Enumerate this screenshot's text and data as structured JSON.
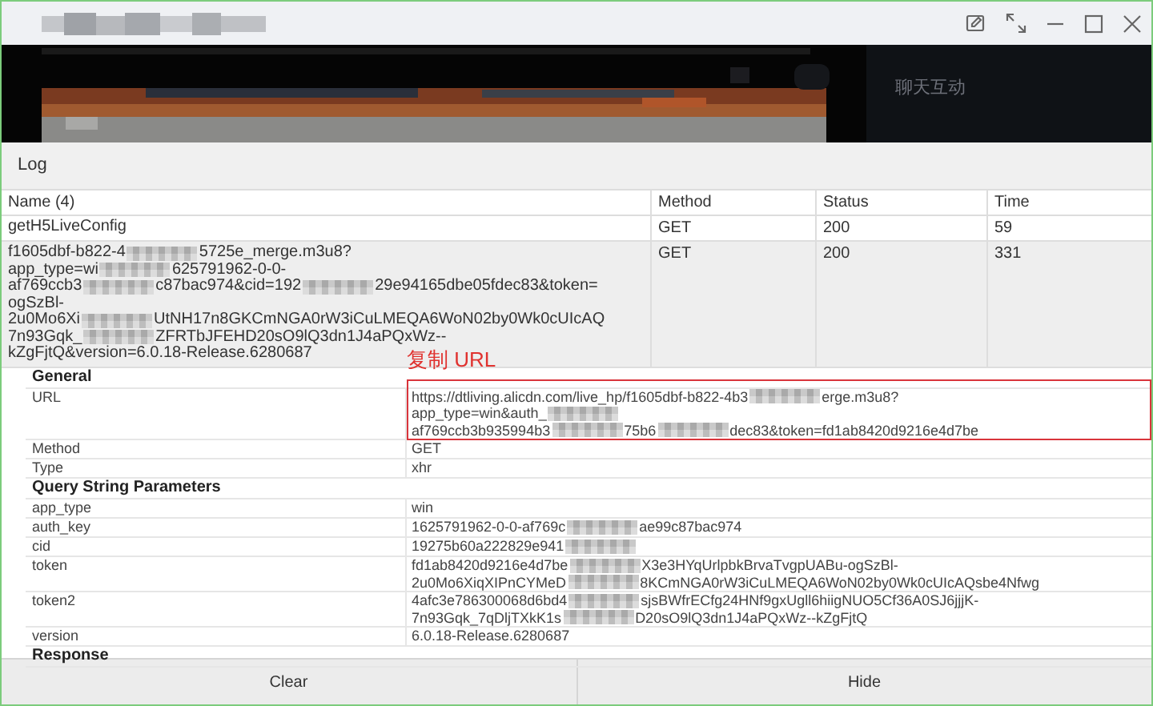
{
  "window": {
    "side_panel_title": "聊天互动"
  },
  "log_bar": {
    "title": "Log"
  },
  "table": {
    "columns": [
      "Name (4)",
      "Method",
      "Status",
      "Time"
    ],
    "rows": [
      {
        "selected": false,
        "name_lines": [
          [
            {
              "kind": "text",
              "text": "getH5LiveConfig"
            }
          ]
        ],
        "method": "GET",
        "status": "200",
        "time": "59"
      },
      {
        "selected": true,
        "name_lines": [
          [
            {
              "kind": "text",
              "text": "f1605dbf-b822-4"
            },
            {
              "kind": "blur"
            },
            {
              "kind": "text",
              "text": "5725e_merge.m3u8?"
            }
          ],
          [
            {
              "kind": "text",
              "text": "app_type=wi"
            },
            {
              "kind": "blur"
            },
            {
              "kind": "text",
              "text": "625791962-0-0-"
            }
          ],
          [
            {
              "kind": "text",
              "text": "af769ccb3"
            },
            {
              "kind": "blur"
            },
            {
              "kind": "text",
              "text": "c87bac974&cid=192"
            },
            {
              "kind": "blur"
            },
            {
              "kind": "text",
              "text": "29e94165dbe05fdec83&token="
            }
          ],
          [
            {
              "kind": "text",
              "text": "ogSzBl-"
            }
          ],
          [
            {
              "kind": "text",
              "text": "2u0Mo6Xi"
            },
            {
              "kind": "blur"
            },
            {
              "kind": "text",
              "text": "UtNH17n8GKCmNGA0rW3iCuLMEQA6WoN02by0Wk0cUIcAQ"
            }
          ],
          [
            {
              "kind": "text",
              "text": "7n93Gqk_"
            },
            {
              "kind": "blur"
            },
            {
              "kind": "text",
              "text": "ZFRTbJFEHD20sO9lQ3dn1J4aPQxWz--"
            }
          ],
          [
            {
              "kind": "text",
              "text": "kZgFjtQ&version=6.0.18-Release.6280687"
            }
          ]
        ],
        "method": "GET",
        "status": "200",
        "time": "331"
      }
    ]
  },
  "annotation": {
    "text": "复制 URL"
  },
  "details": [
    {
      "kind": "heading",
      "label": "General"
    },
    {
      "kind": "field",
      "highlighted": true,
      "label": "URL",
      "lines": [
        [
          {
            "kind": "text",
            "text": "https://dtliving.alicdn.com/live_hp/f1605dbf-b822-4b3"
          },
          {
            "kind": "blur"
          },
          {
            "kind": "text",
            "text": "erge.m3u8?"
          }
        ],
        [
          {
            "kind": "text",
            "text": "app_type=win&auth_"
          },
          {
            "kind": "blur"
          }
        ],
        [
          {
            "kind": "text",
            "text": "af769ccb3b935994b3"
          },
          {
            "kind": "blur"
          },
          {
            "kind": "text",
            "text": "75b6"
          },
          {
            "kind": "blur"
          },
          {
            "kind": "text",
            "text": "dec83&token=fd1ab8420d9216e4d7be"
          }
        ]
      ]
    },
    {
      "kind": "field",
      "highlighted": false,
      "label": "Method",
      "lines": [
        [
          {
            "kind": "text",
            "text": "GET"
          }
        ]
      ]
    },
    {
      "kind": "field",
      "highlighted": false,
      "label": "Type",
      "lines": [
        [
          {
            "kind": "text",
            "text": "xhr"
          }
        ]
      ]
    },
    {
      "kind": "heading",
      "label": "Query String Parameters"
    },
    {
      "kind": "field",
      "highlighted": false,
      "label": "app_type",
      "lines": [
        [
          {
            "kind": "text",
            "text": "win"
          }
        ]
      ]
    },
    {
      "kind": "field",
      "highlighted": false,
      "label": "auth_key",
      "lines": [
        [
          {
            "kind": "text",
            "text": "1625791962-0-0-af769c"
          },
          {
            "kind": "blur"
          },
          {
            "kind": "text",
            "text": "ae99c87bac974"
          }
        ]
      ]
    },
    {
      "kind": "field",
      "highlighted": false,
      "label": "cid",
      "lines": [
        [
          {
            "kind": "text",
            "text": "19275b60a222829e941"
          },
          {
            "kind": "blur"
          }
        ]
      ]
    },
    {
      "kind": "field",
      "highlighted": false,
      "label": "token",
      "lines": [
        [
          {
            "kind": "text",
            "text": "fd1ab8420d9216e4d7be"
          },
          {
            "kind": "blur"
          },
          {
            "kind": "text",
            "text": "X3e3HYqUrlpbkBrvaTvgpUABu-ogSzBl-"
          }
        ],
        [
          {
            "kind": "text",
            "text": "2u0Mo6XiqXIPnCYMeD"
          },
          {
            "kind": "blur"
          },
          {
            "kind": "text",
            "text": "8KCmNGA0rW3iCuLMEQA6WoN02by0Wk0cUIcAQsbe4Nfwg"
          }
        ]
      ]
    },
    {
      "kind": "field",
      "highlighted": false,
      "label": "token2",
      "lines": [
        [
          {
            "kind": "text",
            "text": "4afc3e786300068d6bd4"
          },
          {
            "kind": "blur"
          },
          {
            "kind": "text",
            "text": "sjsBWfrECfg24HNf9gxUgll6hiigNUO5Cf36A0SJ6jjjK-"
          }
        ],
        [
          {
            "kind": "text",
            "text": "7n93Gqk_7qDljTXkK1s"
          },
          {
            "kind": "blur"
          },
          {
            "kind": "text",
            "text": "D20sO9lQ3dn1J4aPQxWz--kZgFjtQ"
          }
        ]
      ]
    },
    {
      "kind": "field",
      "highlighted": false,
      "label": "version",
      "lines": [
        [
          {
            "kind": "text",
            "text": "6.0.18-Release.6280687"
          }
        ]
      ]
    },
    {
      "kind": "heading",
      "label": "Response"
    }
  ],
  "buttons": [
    "Clear",
    "Hide"
  ]
}
